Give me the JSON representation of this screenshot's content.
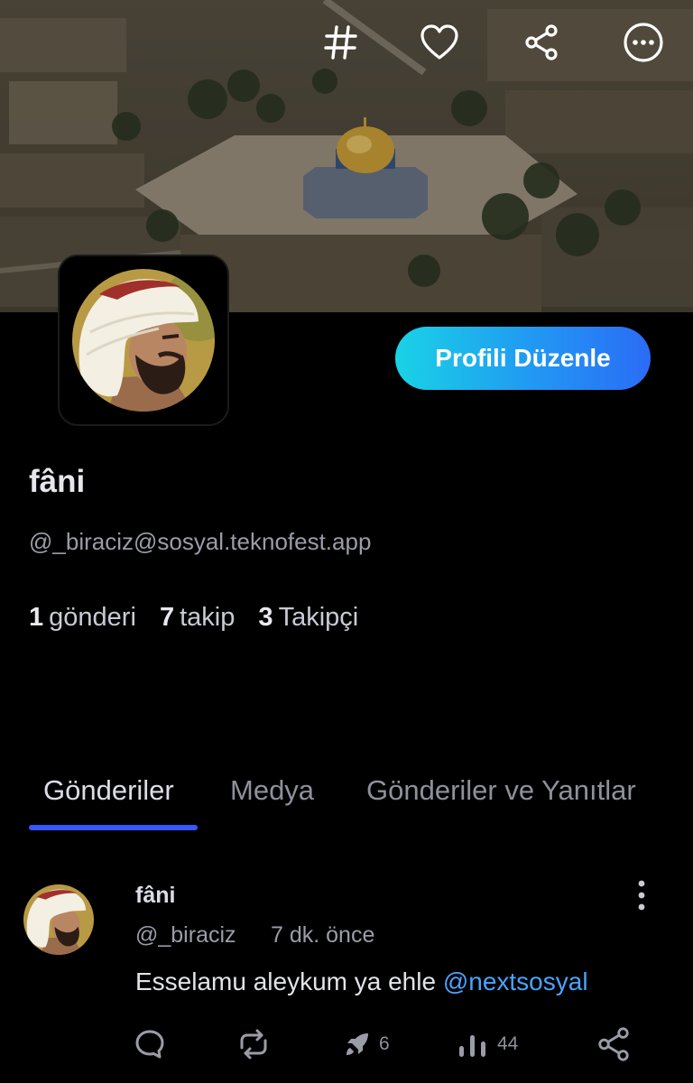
{
  "header": {
    "icons": [
      {
        "name": "hashtag-icon",
        "glyph": "#"
      },
      {
        "name": "heart-icon"
      },
      {
        "name": "share-icon"
      },
      {
        "name": "more-options-icon"
      }
    ]
  },
  "profile": {
    "display_name": "fâni",
    "handle": "@_biraciz@sosyal.teknofest.app",
    "edit_button_label": "Profili Düzenle",
    "stats": [
      {
        "value": "1",
        "label": "gönderi"
      },
      {
        "value": "7",
        "label": "takip"
      },
      {
        "value": "3",
        "label": "Takipçi"
      }
    ]
  },
  "tabs": [
    {
      "label": "Gönderiler",
      "active": true
    },
    {
      "label": "Medya",
      "active": false
    },
    {
      "label": "Gönderiler ve Yanıtlar",
      "active": false
    }
  ],
  "post": {
    "author_name": "fâni",
    "author_handle": "@_biraciz",
    "time": "7 dk. önce",
    "text": "Esselamu aleykum ya ehle ",
    "mention": "@nextsosyal",
    "actions": {
      "reply": {
        "icon": "reply-icon"
      },
      "repost": {
        "icon": "repost-icon"
      },
      "boost": {
        "icon": "rocket-icon",
        "count": "6"
      },
      "views": {
        "icon": "views-icon",
        "count": "44"
      },
      "share": {
        "icon": "share-icon"
      }
    }
  },
  "colors": {
    "background": "#000000",
    "accent": "#3657ff",
    "mention": "#4aa3ff",
    "button_gradient_start": "#19d3e6",
    "button_gradient_end": "#2b6cf6"
  }
}
